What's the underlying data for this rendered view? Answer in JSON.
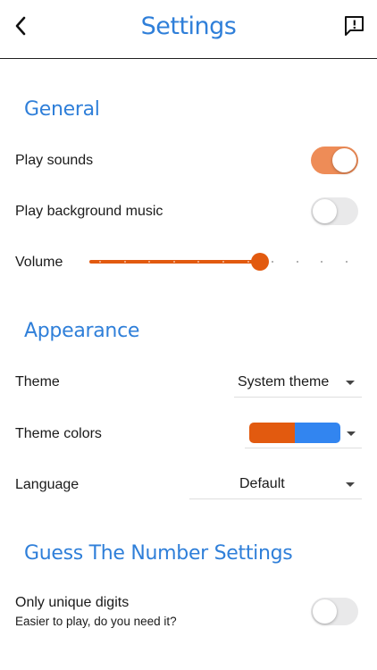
{
  "header": {
    "title": "Settings",
    "back_icon": "chevron-left-icon",
    "feedback_icon": "feedback-icon"
  },
  "general": {
    "title": "General",
    "play_sounds": {
      "label": "Play sounds",
      "on": true
    },
    "background_music": {
      "label": "Play background music",
      "on": false
    },
    "volume": {
      "label": "Volume",
      "level": 0.65,
      "steps": 10
    }
  },
  "appearance": {
    "title": "Appearance",
    "theme": {
      "label": "Theme",
      "value": "System theme"
    },
    "theme_colors": {
      "label": "Theme colors",
      "primary": "#e25a0f",
      "secondary": "#3285f0"
    },
    "language": {
      "label": "Language",
      "value": "Default"
    }
  },
  "game": {
    "title": "Guess The Number Settings",
    "unique_digits": {
      "label": "Only unique digits",
      "sublabel": "Easier to play, do you need it?",
      "on": false
    }
  },
  "colors": {
    "accent_text": "#2f7fd9",
    "toggle_on": "#ee8c57",
    "slider": "#e25a0f"
  }
}
